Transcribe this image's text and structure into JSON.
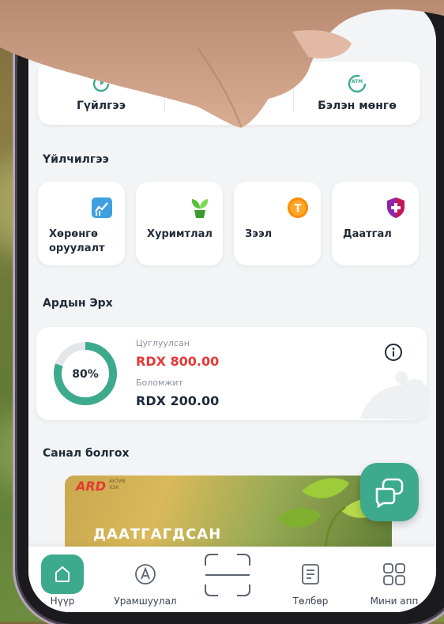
{
  "quick_actions": [
    {
      "label": "Гүйлгээ",
      "icon": "transfer-icon"
    },
    {
      "label": "",
      "icon": ""
    },
    {
      "label": "Бэлэн мөнгө",
      "icon": "atm-icon",
      "icon_text": "ATM"
    }
  ],
  "services": {
    "title": "Үйлчилгээ",
    "items": [
      {
        "label_line1": "Хөрөнгө",
        "label_line2": "оруулалт",
        "icon": "investment-chart-icon"
      },
      {
        "label_line1": "Хуримтлал",
        "label_line2": "",
        "icon": "plant-savings-icon"
      },
      {
        "label_line1": "Зээл",
        "label_line2": "",
        "icon": "loan-coin-icon",
        "icon_text": "T"
      },
      {
        "label_line1": "Даатгал",
        "label_line2": "",
        "icon": "insurance-shield-icon"
      }
    ]
  },
  "ardyn_erkh": {
    "title": "Ардын Эрх",
    "percent_label": "80%",
    "percent_value": 80,
    "collected_label": "Цуглуулсан",
    "collected_value": "RDX 800.00",
    "available_label": "Боломжит",
    "available_value": "RDX 200.00"
  },
  "offers": {
    "title": "Санал болгох",
    "banner_logo": "ARD",
    "banner_logo_sub": "АКТИВ\nХЭК",
    "banner_text": "ДААТГАГДСАН"
  },
  "nav": [
    {
      "label": "Нүүр",
      "icon": "home-icon"
    },
    {
      "label": "Урамшуулал",
      "icon": "rewards-icon"
    },
    {
      "label": "",
      "icon": "scan-icon"
    },
    {
      "label": "Төлбөр",
      "icon": "bill-icon"
    },
    {
      "label": "Мини апп",
      "icon": "mini-apps-icon"
    }
  ],
  "colors": {
    "accent": "#3daa8e",
    "red": "#e53935",
    "text": "#1f2a37"
  }
}
